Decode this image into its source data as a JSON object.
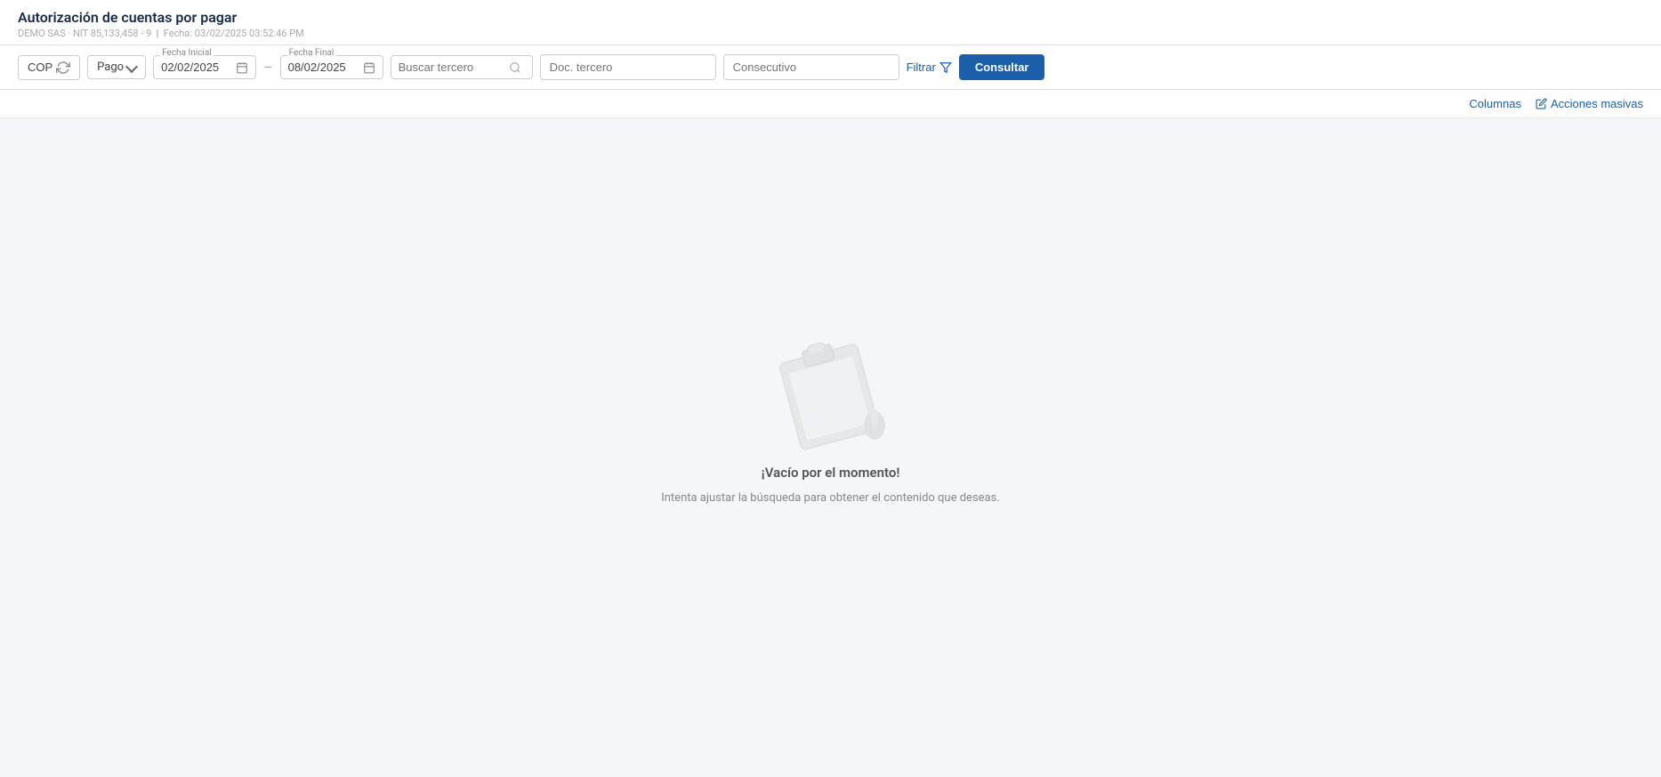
{
  "page": {
    "title": "Autorización de cuentas por pagar",
    "company": "DEMO SAS",
    "nit": "NIT 85,133,458 - 9",
    "fecha_label": "Fecha:",
    "fecha_value": "03/02/2025 03:52:46 PM"
  },
  "toolbar": {
    "currency": "COP",
    "pago_label": "Pago",
    "fecha_inicial_label": "Fecha Inicial",
    "fecha_inicial_value": "02/02/2025",
    "fecha_final_label": "Fecha Final",
    "fecha_final_value": "08/02/2025",
    "buscar_tercero_placeholder": "Buscar tercero",
    "doc_tercero_placeholder": "Doc. tercero",
    "consecutivo_placeholder": "Consecutivo",
    "filtrar_label": "Filtrar",
    "consultar_label": "Consultar"
  },
  "actions_bar": {
    "columnas_label": "Columnas",
    "acciones_label": "Acciones masivas"
  },
  "empty_state": {
    "icon_label": "empty-clipboard-icon",
    "title": "¡Vacío por el momento!",
    "subtitle": "Intenta ajustar la búsqueda para obtener el contenido que deseas."
  }
}
